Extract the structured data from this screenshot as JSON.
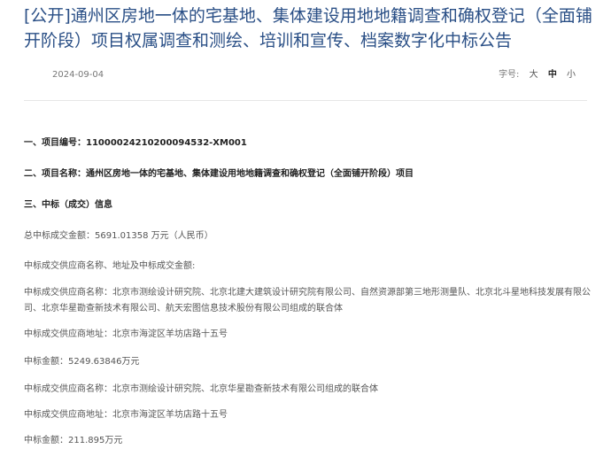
{
  "announcement": {
    "title": "[公开]通州区房地一体的宅基地、集体建设用地地籍调查和确权登记（全面铺开阶段）项目权属调查和测绘、培训和宣传、档案数字化中标公告",
    "date": "2024-09-04",
    "font_size_label": "字号:",
    "font_size_options": [
      "大",
      "中",
      "小"
    ]
  },
  "content": {
    "project_number": "一、项目编号：11000024210200094532-XM001",
    "project_name": "二、项目名称：通州区房地一体的宅基地、集体建设用地地籍调查和确权登记（全面铺开阶段）项目",
    "section_three": "三、中标（成交）信息",
    "total_amount": "总中标成交金额：5691.01358 万元（人民币）",
    "supplier_intro": "中标成交供应商名称、地址及中标成交金额:",
    "supplier1_name": "中标成交供应商名称：北京市测绘设计研究院、北京北建大建筑设计研究院有限公司、自然资源部第三地形测量队、北京北斗星地科技发展有限公司、北京华星勘查新技术有限公司、航天宏图信息技术股份有限公司组成的联合体",
    "supplier1_address": "中标成交供应商地址：北京市海淀区羊坊店路十五号",
    "supplier1_amount": "中标金额：5249.63846万元",
    "supplier2_name": "中标成交供应商名称：北京市测绘设计研究院、北京华星勘查新技术有限公司组成的联合体",
    "supplier2_address": "中标成交供应商地址：北京市海淀区羊坊店路十五号",
    "supplier2_amount": "中标金额：211.895万元"
  }
}
